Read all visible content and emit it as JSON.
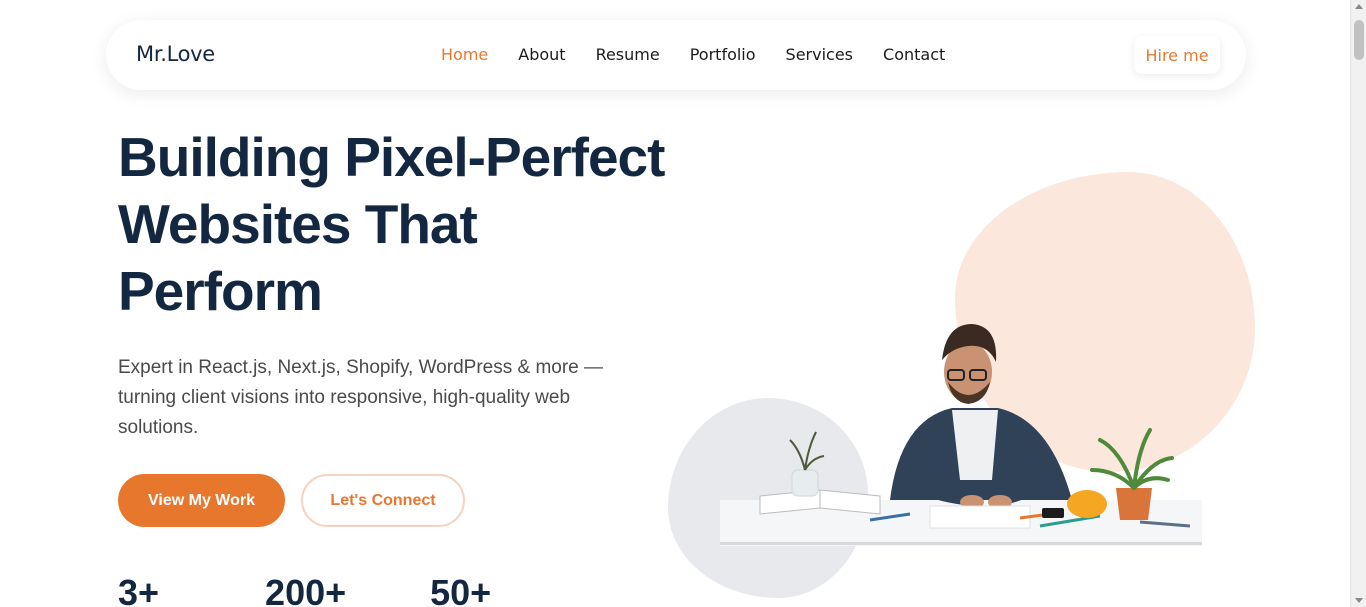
{
  "nav": {
    "logo": "Mr.Love",
    "items": [
      {
        "label": "Home",
        "active": true
      },
      {
        "label": "About",
        "active": false
      },
      {
        "label": "Resume",
        "active": false
      },
      {
        "label": "Portfolio",
        "active": false
      },
      {
        "label": "Services",
        "active": false
      },
      {
        "label": "Contact",
        "active": false
      }
    ],
    "hire_label": "Hire me"
  },
  "hero": {
    "title_line1": "Building Pixel-Perfect",
    "title_line2": "Websites That",
    "title_line3": "Perform",
    "subtitle": "Expert in React.js, Next.js, Shopify, WordPress & more — turning client visions into responsive, high-quality web solutions.",
    "primary_button": "View My Work",
    "secondary_button": "Let's Connect",
    "stats": [
      "3+",
      "200+",
      "50+"
    ]
  },
  "colors": {
    "accent": "#e8772e",
    "heading": "#132840",
    "peach_blob": "#fbe7dc",
    "grey_blob": "#e8e9ec"
  },
  "icons": {
    "hero_image": "developer-at-desk-illustration"
  }
}
